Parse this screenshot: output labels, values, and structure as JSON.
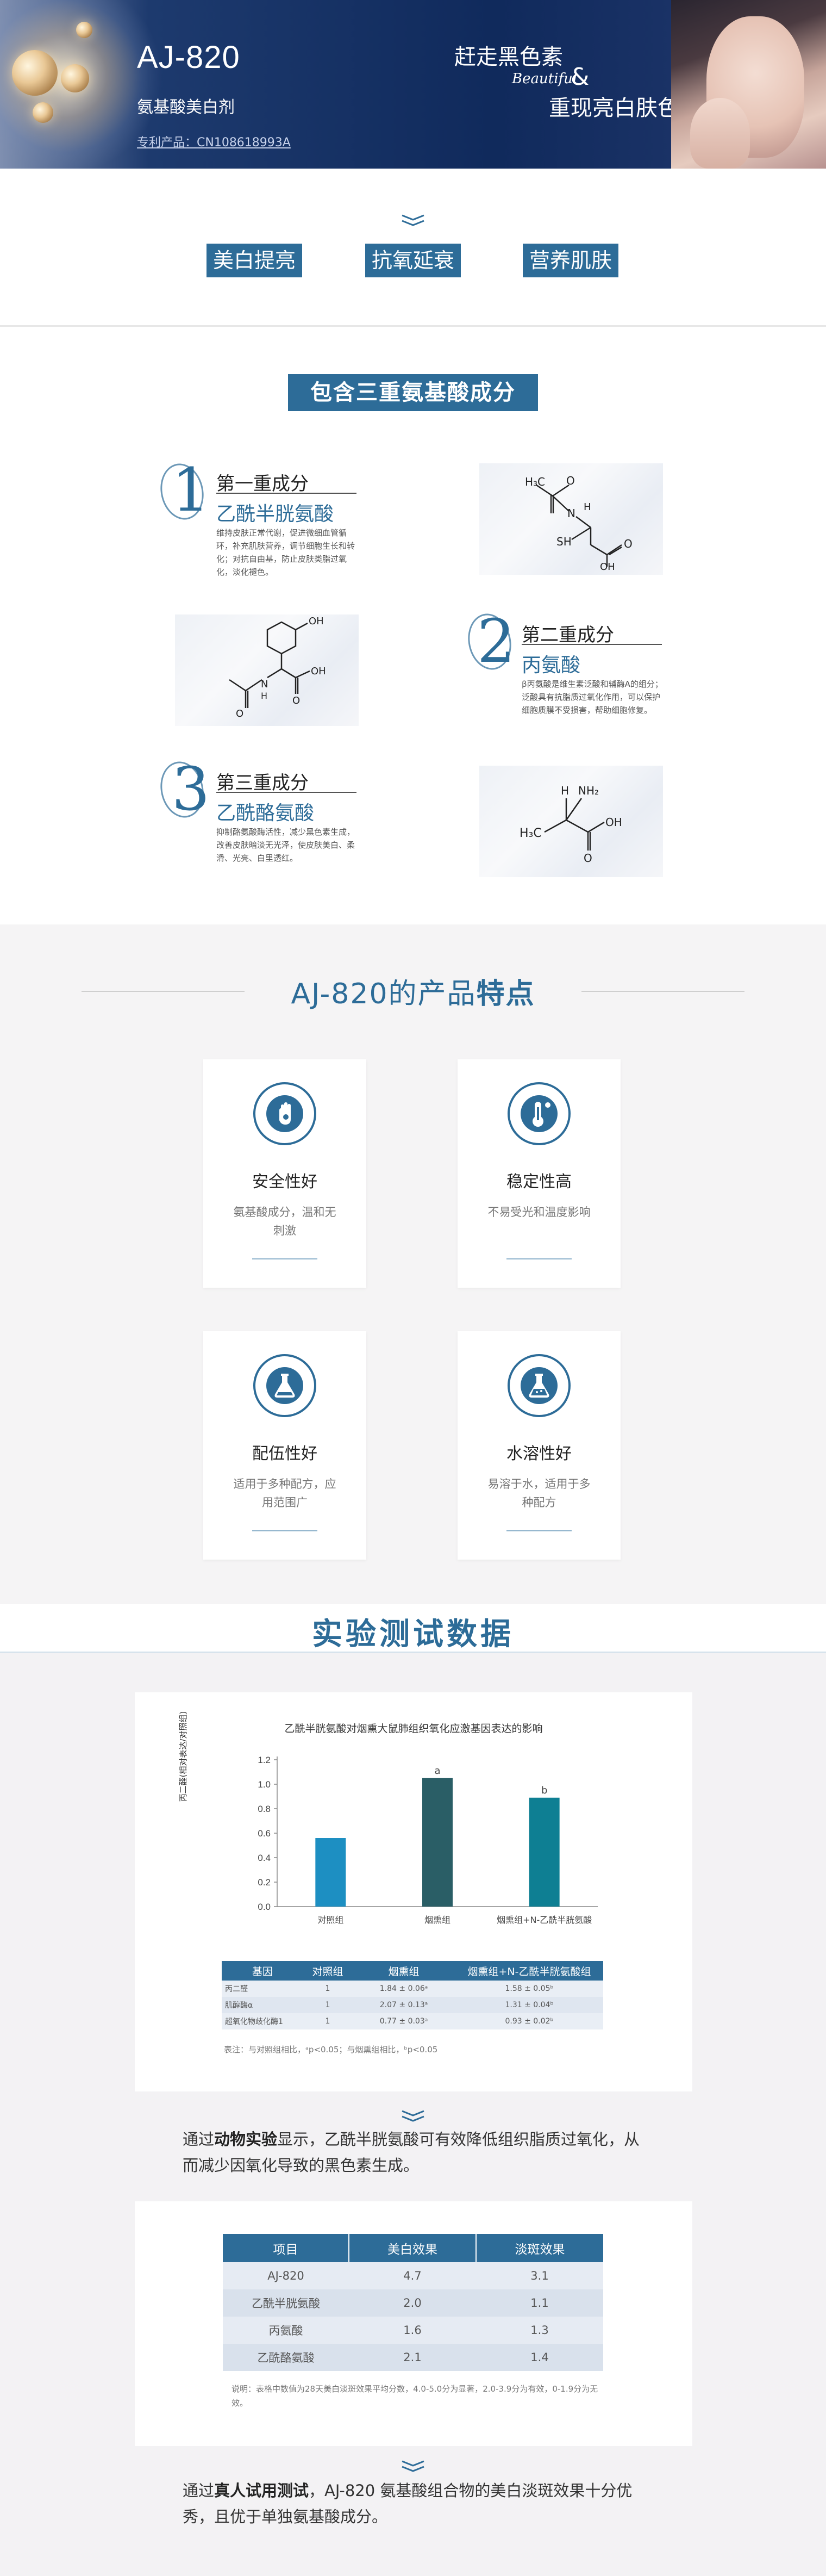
{
  "hero": {
    "title": "AJ-820",
    "subtitle": "氨基酸美白剂",
    "patent": "专利产品：CN108618993A",
    "slogan1": "赶走黑色素",
    "script": "Beautiful",
    "amp": "&",
    "slogan2": "重现亮白肤色"
  },
  "tags": [
    "美白提亮",
    "抗氧延衰",
    "营养肌肤"
  ],
  "ingredients_section": {
    "title": "包含三重氨基酸成分",
    "items": [
      {
        "num": "1",
        "head": "第一重成分",
        "name": "乙酰半胱氨酸",
        "desc": "维持皮肤正常代谢，促进微细血管循环，补充肌肤营养，调节细胞生长和转化；对抗自由基，防止皮肤类脂过氧化，淡化褪色。"
      },
      {
        "num": "2",
        "head": "第二重成分",
        "name": "丙氨酸",
        "desc": "β丙氨酸是维生素泛酸和辅酶A的组分；泛酸具有抗脂质过氧化作用，可以保护细胞质膜不受损害，帮助细胞修复。"
      },
      {
        "num": "3",
        "head": "第三重成分",
        "name": "乙酰酪氨酸",
        "desc": "抑制酪氨酸酶活性，减少黑色素生成，改善皮肤暗淡无光泽，使皮肤美白、柔滑、光亮、白里透红。"
      }
    ],
    "molecules": {
      "m1": {
        "a": "H₃C",
        "b": "O",
        "c": "N",
        "d": "H",
        "e": "SH",
        "f": "O",
        "g": "OH"
      },
      "m2": {
        "a": "OH",
        "b": "O",
        "c": "N",
        "d": "H",
        "e": "OH",
        "f": "O"
      },
      "m3": {
        "a": "H",
        "b": "NH₂",
        "c": "H₃C",
        "d": "OH",
        "e": "O"
      }
    }
  },
  "features": {
    "title_prefix": "AJ-820的产品",
    "title_bold": "特点",
    "cards": [
      {
        "icon": "hand-shield-icon",
        "head": "安全性好",
        "desc": "氨基酸成分，温和无刺激"
      },
      {
        "icon": "thermometer-icon",
        "head": "稳定性高",
        "desc": "不易受光和温度影响"
      },
      {
        "icon": "flask-icon",
        "head": "配伍性好",
        "desc": "适用于多种配方，应用范围广"
      },
      {
        "icon": "beaker-icon",
        "head": "水溶性好",
        "desc": "易溶于水，适用于多种配方"
      }
    ]
  },
  "data_section": {
    "title": "实验测试数据",
    "chart_data": {
      "type": "bar",
      "title": "乙酰半胱氨酸对烟熏大鼠肺组织氧化应激基因表达的影响",
      "ylabel": "丙二醛(相对表达/对照组)",
      "categories": [
        "对照组",
        "烟熏组",
        "烟熏组+N-乙酰半胱氨酸"
      ],
      "values": [
        0.56,
        1.05,
        0.89
      ],
      "data_labels": [
        "",
        "a",
        "b"
      ],
      "colors": [
        "#1d8fc2",
        "#2a5e66",
        "#0e7f93"
      ],
      "ylim": [
        0,
        1.2
      ],
      "yticks": [
        "0.0",
        "0.2",
        "0.4",
        "0.6",
        "0.8",
        "1.0",
        "1.2"
      ]
    },
    "table1": {
      "headers": [
        "基因",
        "对照组",
        "烟熏组",
        "烟熏组+N-乙酰半胱氨酸组"
      ],
      "rows": [
        [
          "丙二醛",
          "1",
          "1.84 ± 0.06ᵃ",
          "1.58 ± 0.05ᵇ"
        ],
        [
          "肌醇酶α",
          "1",
          "2.07 ± 0.13ᵃ",
          "1.31 ± 0.04ᵇ"
        ],
        [
          "超氧化物歧化酶1",
          "1",
          "0.77 ± 0.03ᵃ",
          "0.93 ± 0.02ᵇ"
        ]
      ],
      "note": "表注：与对照组相比，ᵃp<0.05；与烟熏组相比，ᵇp<0.05"
    },
    "para1_pre": "通过",
    "para1_bold": "动物实验",
    "para1_post": "显示，乙酰半胱氨酸可有效降低组织脂质过氧化，从而减少因氧化导致的黑色素生成。",
    "table2": {
      "headers": [
        "项目",
        "美白效果",
        "淡斑效果"
      ],
      "rows": [
        [
          "AJ-820",
          "4.7",
          "3.1"
        ],
        [
          "乙酰半胱氨酸",
          "2.0",
          "1.1"
        ],
        [
          "丙氨酸",
          "1.6",
          "1.3"
        ],
        [
          "乙酰酪氨酸",
          "2.1",
          "1.4"
        ]
      ],
      "note": "说明：表格中数值为28天美白淡斑效果平均分数，4.0-5.0分为显著，2.0-3.9分为有效，0-1.9分为无效。"
    },
    "para2_pre": "通过",
    "para2_bold": "真人试用测试",
    "para2_post": "，AJ-820 氨基酸组合物的美白淡斑效果十分优秀，且优于单独氨基酸成分。"
  }
}
